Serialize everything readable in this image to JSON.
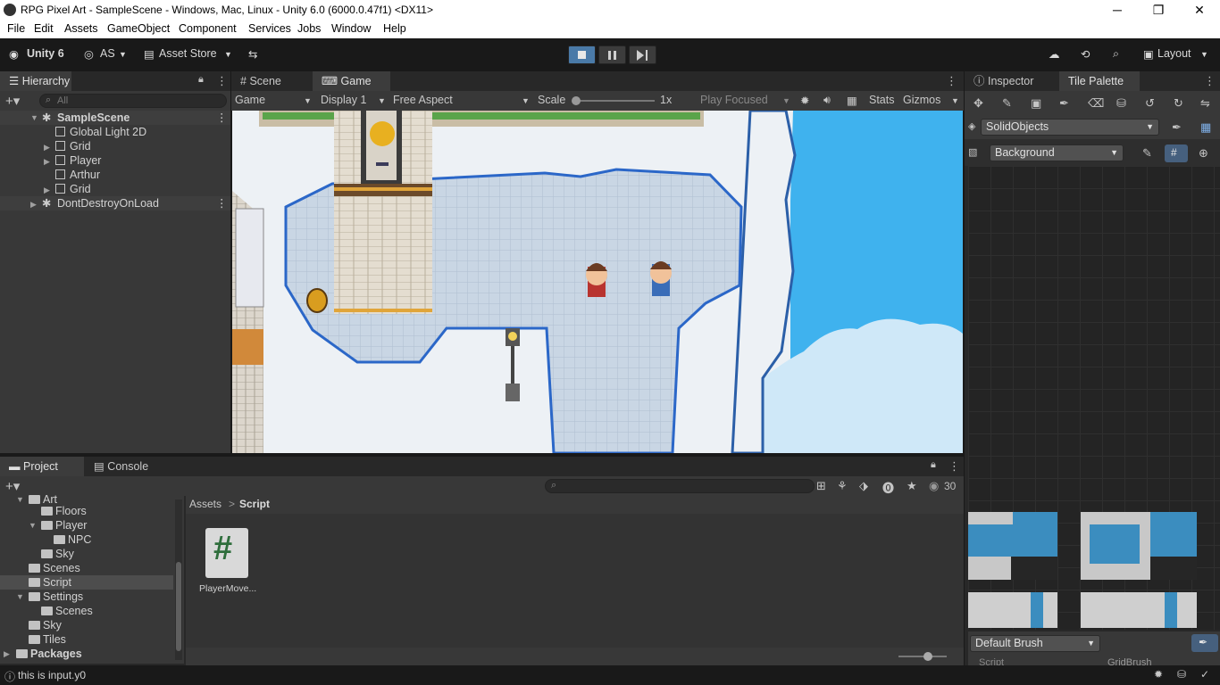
{
  "window": {
    "title": "RPG Pixel Art - SampleScene - Windows, Mac, Linux - Unity 6.0 (6000.0.47f1) <DX11>",
    "minimize": "─",
    "maximize": "❐",
    "close": "✕"
  },
  "menu": [
    "File",
    "Edit",
    "Assets",
    "GameObject",
    "Component",
    "Services",
    "Jobs",
    "Window",
    "Help"
  ],
  "toolbar": {
    "unity_label": "Unity 6",
    "account": "AS",
    "asset_store": "Asset Store",
    "layout": "Layout"
  },
  "hierarchy": {
    "tab": "Hierarchy",
    "search_placeholder": "All",
    "scene": "SampleScene",
    "items": [
      "Global Light 2D",
      "Grid",
      "Player",
      "Arthur",
      "Grid"
    ],
    "dont_destroy": "DontDestroyOnLoad"
  },
  "views": {
    "scene_tab": "Scene",
    "game_tab": "Game"
  },
  "game_toolbar": {
    "mode": "Game",
    "display": "Display 1",
    "aspect": "Free Aspect",
    "scale_label": "Scale",
    "scale_value": "1x",
    "play_focused": "Play Focused",
    "stats": "Stats",
    "gizmos": "Gizmos"
  },
  "inspector": {
    "tab": "Inspector",
    "palette_tab": "Tile Palette",
    "palette": "SolidObjects",
    "layer": "Background",
    "brush": "Default Brush",
    "script_label": "Script",
    "brush_script": "GridBrush"
  },
  "project": {
    "tab": "Project",
    "console_tab": "Console",
    "tree": [
      "Art",
      "Floors",
      "Player",
      "NPC",
      "Sky",
      "Scenes",
      "Script",
      "Settings",
      "Scenes",
      "Sky",
      "Tiles",
      "Packages"
    ],
    "breadcrumb": [
      "Assets",
      "Script"
    ],
    "asset_name": "PlayerMove...",
    "asset_glyph": "#",
    "count": "30"
  },
  "status": {
    "message": "this is input.y0"
  }
}
